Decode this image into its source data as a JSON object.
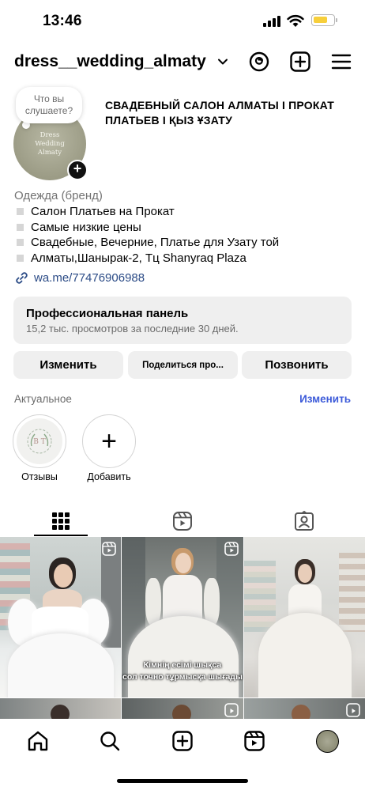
{
  "status_bar": {
    "time": "13:46",
    "battery_color": "#f7cf3b"
  },
  "header": {
    "username": "dress__wedding_almaty",
    "icons": [
      "chevron-down-icon",
      "threads-icon",
      "create-icon",
      "menu-icon"
    ]
  },
  "profile": {
    "note": "Что вы слушаете?",
    "avatar_text": [
      "Dress",
      "Wedding",
      "Almaty"
    ],
    "add_story_symbol": "+",
    "display_name": "СВАДЕБНЫЙ САЛОН АЛМАТЫ І ПРОКАТ ПЛАТЬЕВ І ҚЫЗ ҰЗАТУ"
  },
  "bio": {
    "category": "Одежда (бренд)",
    "lines": [
      "Салон Платьев на Прокат",
      "Самые низкие цены",
      "Свадебные, Вечерние, Платье для Узату той",
      "Алматы,Шанырак-2, Тц Shanyraq Plaza"
    ],
    "link": "wa.me/77476906988",
    "link_color": "#2b4b86"
  },
  "pro_panel": {
    "title": "Профессиональная панель",
    "subtitle": "15,2 тыс. просмотров за последние 30 дней."
  },
  "buttons": {
    "edit": "Изменить",
    "share": "Поделиться про...",
    "call": "Позвонить"
  },
  "highlights": {
    "title": "Актуальное",
    "edit": "Изменить",
    "edit_color": "#3d5bd9",
    "items": [
      {
        "label": "Отзывы",
        "logo": "B T"
      },
      {
        "label": "Добавить",
        "symbol": "+"
      }
    ]
  },
  "tabs": [
    "grid-icon",
    "reels-icon",
    "tagged-icon"
  ],
  "grid": {
    "caption": [
      "Кімнің есімі шықса",
      "сол точно тұрмысқа шығады"
    ]
  },
  "bottom_nav": [
    "home-icon",
    "search-icon",
    "create-icon",
    "reels-icon",
    "profile-avatar"
  ]
}
